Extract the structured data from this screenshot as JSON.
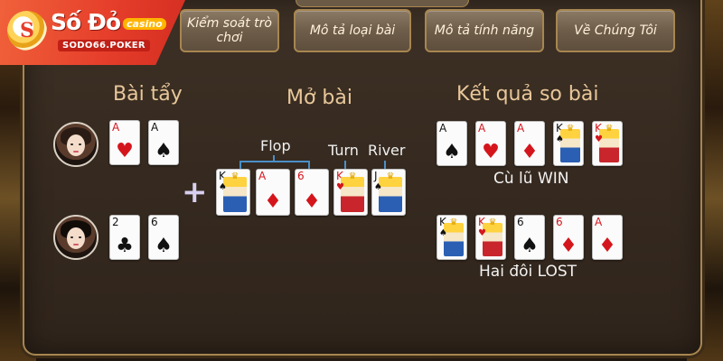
{
  "logo": {
    "name": "Số Đỏ",
    "tag": "casino",
    "url": "SODO66.POKER",
    "mark": "S"
  },
  "nav": [
    {
      "label": "Kiểm soát trò chơi"
    },
    {
      "label": "Mô tả loại bài"
    },
    {
      "label": "Mô tả tính năng"
    },
    {
      "label": "Về Chúng Tôi"
    }
  ],
  "headings": {
    "hole": "Bài tẩy",
    "board": "Mở bài",
    "result": "Kết quả so bài"
  },
  "board_labels": {
    "flop": "Flop",
    "turn": "Turn",
    "river": "River"
  },
  "plus_sign": "+",
  "players": [
    {
      "hand": [
        {
          "rank": "A",
          "suit": "♥",
          "color": "red"
        },
        {
          "rank": "A",
          "suit": "♠",
          "color": "black"
        }
      ]
    },
    {
      "hand": [
        {
          "rank": "2",
          "suit": "♣",
          "color": "black"
        },
        {
          "rank": "6",
          "suit": "♠",
          "color": "black"
        }
      ]
    }
  ],
  "board": [
    {
      "rank": "K",
      "suit": "♠",
      "color": "black",
      "face": true
    },
    {
      "rank": "A",
      "suit": "♦",
      "color": "red"
    },
    {
      "rank": "6",
      "suit": "♦",
      "color": "red"
    },
    {
      "rank": "K",
      "suit": "♥",
      "color": "red",
      "face": true
    },
    {
      "rank": "J",
      "suit": "♠",
      "color": "black",
      "face": true
    }
  ],
  "results": [
    {
      "text": "Cù lũ WIN",
      "cards": [
        {
          "rank": "A",
          "suit": "♠",
          "color": "black"
        },
        {
          "rank": "A",
          "suit": "♥",
          "color": "red"
        },
        {
          "rank": "A",
          "suit": "♦",
          "color": "red"
        },
        {
          "rank": "K",
          "suit": "♠",
          "color": "black",
          "face": true
        },
        {
          "rank": "K",
          "suit": "♥",
          "color": "red",
          "face": true
        }
      ]
    },
    {
      "text": "Hai đôi LOST",
      "cards": [
        {
          "rank": "K",
          "suit": "♠",
          "color": "black",
          "face": true
        },
        {
          "rank": "K",
          "suit": "♥",
          "color": "red",
          "face": true
        },
        {
          "rank": "6",
          "suit": "♠",
          "color": "black"
        },
        {
          "rank": "6",
          "suit": "♦",
          "color": "red"
        },
        {
          "rank": "A",
          "suit": "♦",
          "color": "red"
        }
      ]
    }
  ],
  "colors": {
    "accent": "#a78650",
    "heading": "#e8c79a",
    "logo_red": "#e53d2a",
    "bracket": "#4a8fc7"
  }
}
